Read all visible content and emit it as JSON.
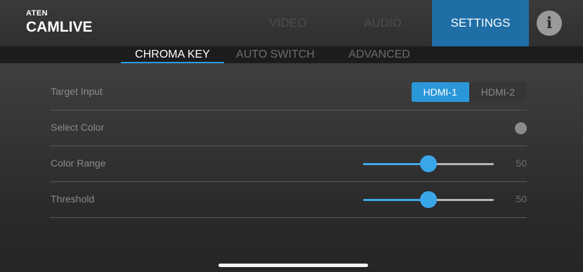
{
  "header": {
    "brand": "ATEN",
    "product": "CAMLIVE",
    "tabs": [
      {
        "label": "VIDEO",
        "active": false
      },
      {
        "label": "AUDIO",
        "active": false
      },
      {
        "label": "SETTINGS",
        "active": true
      }
    ],
    "info_icon": "info-icon",
    "info_glyph": "i"
  },
  "subtabs": [
    {
      "label": "CHROMA KEY",
      "active": true
    },
    {
      "label": "AUTO SWITCH",
      "active": false
    },
    {
      "label": "ADVANCED",
      "active": false
    }
  ],
  "settings": {
    "target_input": {
      "label": "Target Input",
      "options": [
        "HDMI-1",
        "HDMI-2"
      ],
      "selected": "HDMI-1"
    },
    "select_color": {
      "label": "Select Color",
      "color": "#8c8c8e"
    },
    "color_range": {
      "label": "Color Range",
      "value": 50,
      "min": 0,
      "max": 100,
      "value_text": "50"
    },
    "threshold": {
      "label": "Threshold",
      "value": 50,
      "min": 0,
      "max": 100,
      "value_text": "50"
    }
  },
  "colors": {
    "accent": "#2a97d9",
    "active_tab_bg": "#1f6ea6",
    "slider_fill": "#3ea8ea"
  }
}
